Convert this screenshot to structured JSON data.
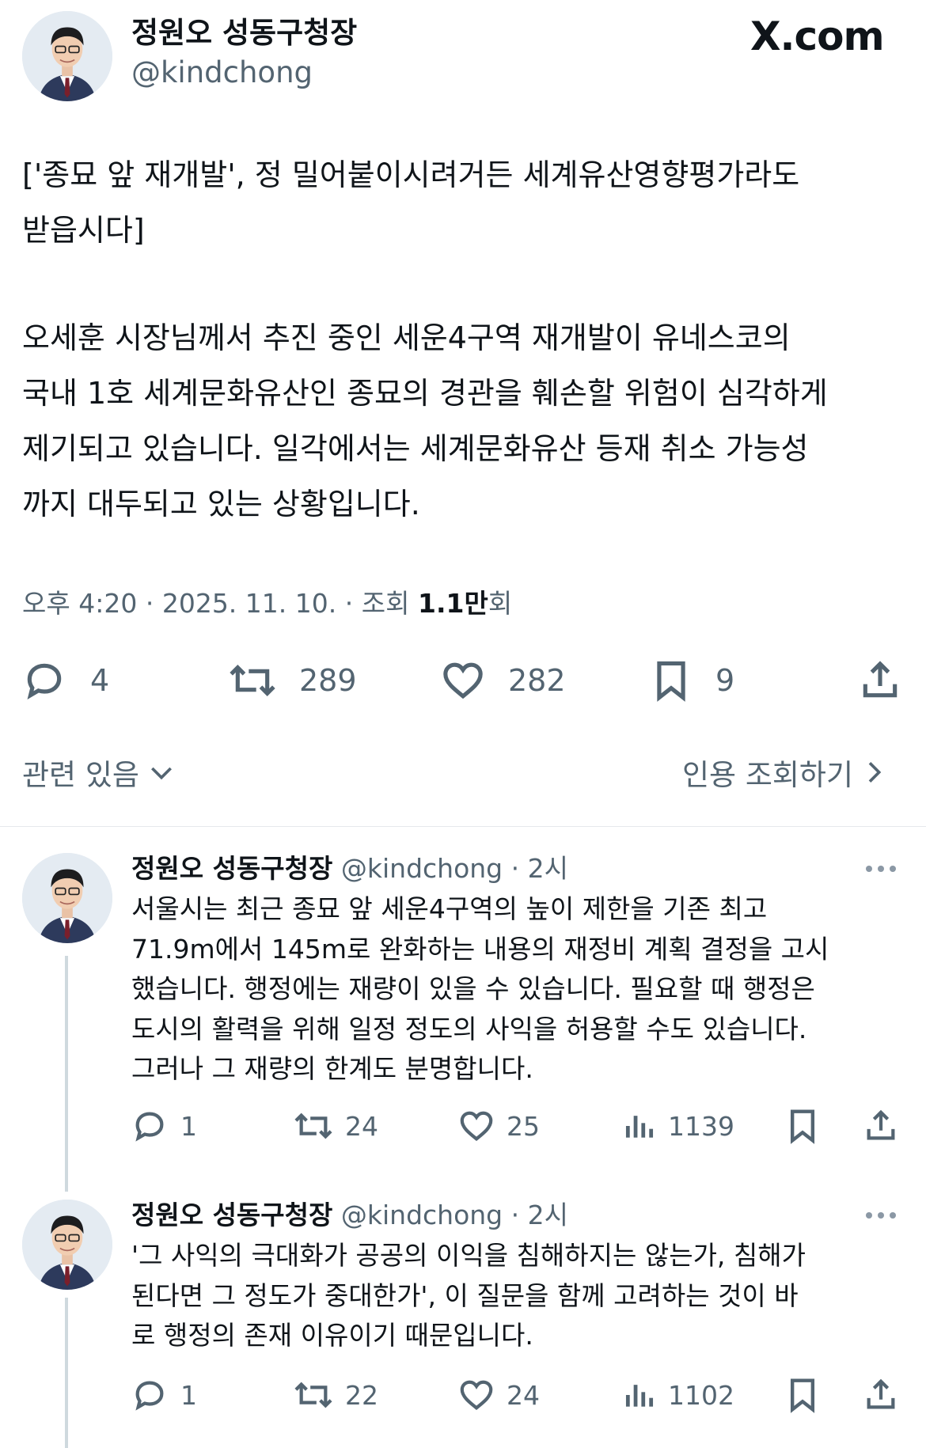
{
  "header": {
    "author_name": "정원오 성동구청장",
    "author_handle": "@kindchong",
    "brand": "X.com"
  },
  "tweet": {
    "title_line": "['종묘 앞 재개발', 정 밀어붙이시려거든 세계유산영향평가라도\n받읍시다]",
    "body": "오세훈 시장님께서 추진 중인 세운4구역 재개발이 유네스코의\n국내 1호 세계문화유산인 종묘의 경관을 훼손할 위험이 심각하게\n제기되고 있습니다. 일각에서는 세계문화유산 등재 취소 가능성\n까지 대두되고 있는 상황입니다.",
    "time": "오후 4:20",
    "date": "2025. 11. 10.",
    "views_label": "조회",
    "views_value": "1.1만",
    "views_suffix": "회",
    "sep": "·",
    "stats": {
      "replies": "4",
      "retweets": "289",
      "likes": "282",
      "bookmarks": "9"
    }
  },
  "related": {
    "left_label": "관련 있음",
    "right_label": "인용 조회하기"
  },
  "replies": [
    {
      "author_name": "정원오 성동구청장",
      "author_handle": "@kindchong",
      "time": "· 2시",
      "text": "서울시는 최근 종묘 앞 세운4구역의 높이 제한을 기존 최고\n71.9m에서 145m로 완화하는 내용의 재정비 계획 결정을 고시\n했습니다. 행정에는 재량이 있을 수 있습니다. 필요할 때 행정은\n도시의 활력을 위해 일정 정도의 사익을 허용할 수도 있습니다.\n그러나 그 재량의 한계도 분명합니다.",
      "stats": {
        "replies": "1",
        "retweets": "24",
        "likes": "25",
        "views": "1139"
      }
    },
    {
      "author_name": "정원오 성동구청장",
      "author_handle": "@kindchong",
      "time": "· 2시",
      "text": "'그 사익의 극대화가 공공의 이익을 침해하지는 않는가, 침해가\n된다면 그 정도가 중대한가', 이 질문을 함께 고려하는 것이 바\n로 행정의 존재 이유이기 때문입니다.",
      "stats": {
        "replies": "1",
        "retweets": "22",
        "likes": "24",
        "views": "1102"
      }
    }
  ],
  "icons": {
    "reply": "reply-icon",
    "retweet": "retweet-icon",
    "like": "heart-icon",
    "bookmark": "bookmark-icon",
    "share": "share-icon",
    "views": "views-icon",
    "chevron_down": "chevron-down-icon",
    "chevron_right": "chevron-right-icon",
    "more": "more-icon"
  },
  "colors": {
    "text": "#0f1419",
    "secondary": "#536471",
    "divider": "#e6e9ec",
    "thread_line": "#cfd9de"
  }
}
